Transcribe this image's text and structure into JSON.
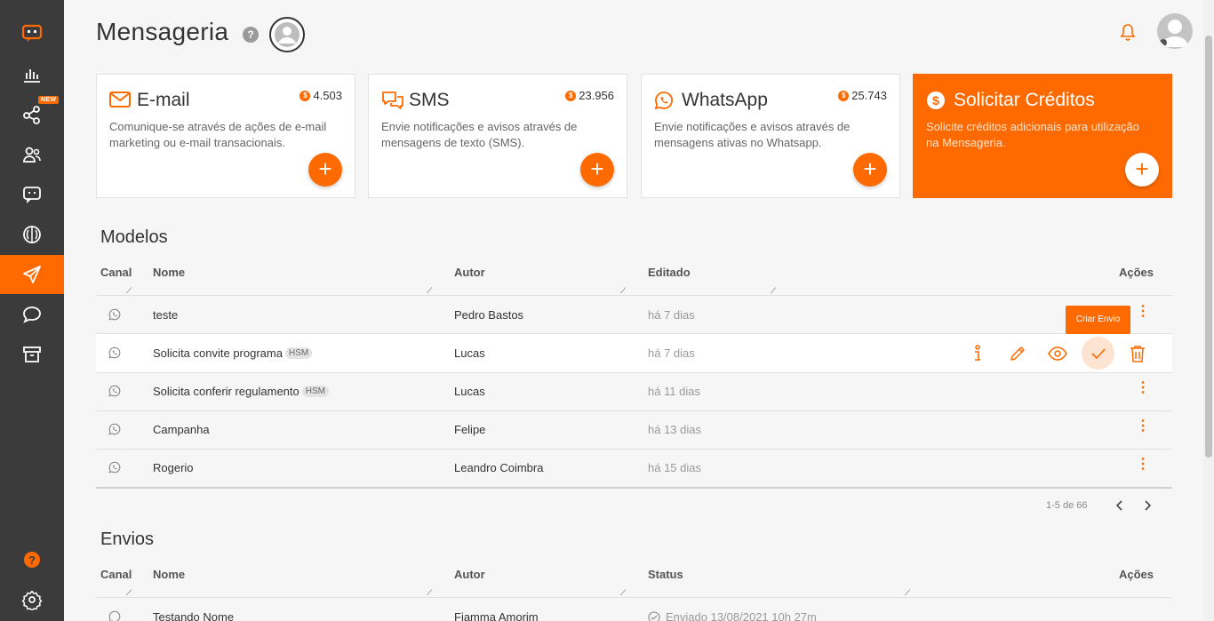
{
  "header": {
    "title": "Mensageria",
    "help": "?"
  },
  "cards": [
    {
      "title": "E-mail",
      "credits": "4.503",
      "desc": "Comunique-se através de ações de e-mail marketing ou e-mail transacionais.",
      "button": "+"
    },
    {
      "title": "SMS",
      "credits": "23.956",
      "desc": "Envie notificações e avisos através de mensagens de texto (SMS).",
      "button": "+"
    },
    {
      "title": "WhatsApp",
      "credits": "25.743",
      "desc": "Envie notificações e avisos através de mensagens ativas no Whatsapp.",
      "button": "+"
    },
    {
      "title": "Solicitar Créditos",
      "desc": "Solicite créditos adicionais para utilização na Mensageria.",
      "button": "+"
    }
  ],
  "coin_symbol": "$",
  "new_badge": "NEW",
  "modelos": {
    "title": "Modelos",
    "headers": {
      "canal": "Canal",
      "nome": "Nome",
      "autor": "Autor",
      "editado": "Editado",
      "acoes": "Ações"
    },
    "rows": [
      {
        "nome": "teste",
        "hsm": "",
        "autor": "Pedro Bastos",
        "editado": "há 7 dias"
      },
      {
        "nome": "Solicita convite programa",
        "hsm": "HSM",
        "autor": "Lucas",
        "editado": "há 7 dias"
      },
      {
        "nome": "Solicita conferir regulamento",
        "hsm": "HSM",
        "autor": "Lucas",
        "editado": "há 11 dias"
      },
      {
        "nome": "Campanha",
        "hsm": "",
        "autor": "Felipe",
        "editado": "há 13 dias"
      },
      {
        "nome": "Rogerio",
        "hsm": "",
        "autor": "Leandro Coimbra",
        "editado": "há 15 dias"
      }
    ],
    "tooltip": "Criar Envio",
    "pagination": "1-5 de 66",
    "dots": "⋮"
  },
  "envios": {
    "title": "Envios",
    "headers": {
      "canal": "Canal",
      "nome": "Nome",
      "autor": "Autor",
      "status": "Status",
      "acoes": "Ações"
    },
    "rows": [
      {
        "nome": "Testando Nome",
        "autor": "Fiamma Amorim",
        "status": "Enviado 13/08/2021 10h 27m"
      }
    ]
  },
  "colors": {
    "accent": "#ff6a00",
    "sidebar": "#3b3b3b"
  }
}
